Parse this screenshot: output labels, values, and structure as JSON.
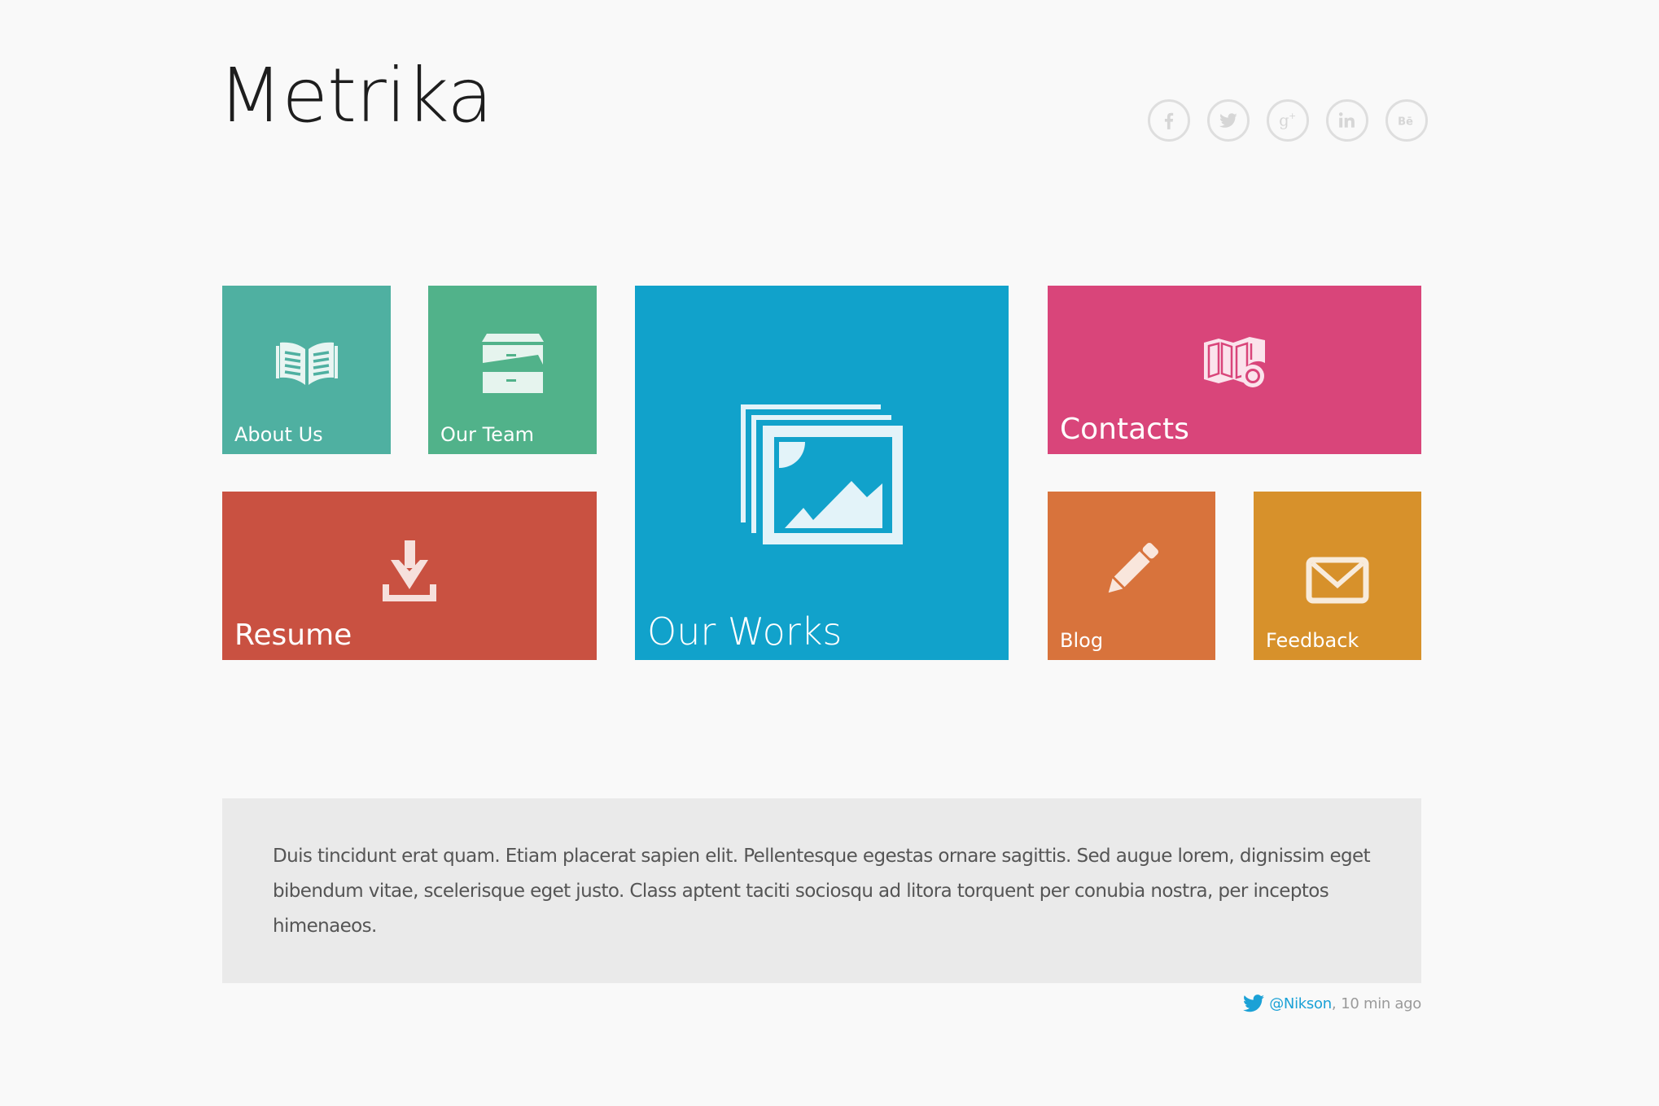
{
  "header": {
    "title": "Metrika",
    "social": [
      {
        "name": "facebook",
        "icon": "facebook-icon"
      },
      {
        "name": "twitter",
        "icon": "twitter-icon"
      },
      {
        "name": "google-plus",
        "icon": "google-plus-icon"
      },
      {
        "name": "linkedin",
        "icon": "linkedin-icon"
      },
      {
        "name": "behance",
        "icon": "behance-icon"
      }
    ]
  },
  "tiles": [
    {
      "label": "About Us",
      "icon": "open-book-icon",
      "color": "#4fb0a1"
    },
    {
      "label": "Our Team",
      "icon": "file-cabinet-icon",
      "color": "#51b28a"
    },
    {
      "label": "Our Works",
      "icon": "image-gallery-icon",
      "color": "#11a2cb"
    },
    {
      "label": "Contacts",
      "icon": "map-pin-icon",
      "color": "#d9457a"
    },
    {
      "label": "Resume",
      "icon": "download-icon",
      "color": "#c95141"
    },
    {
      "label": "Blog",
      "icon": "pencil-icon",
      "color": "#d8733c"
    },
    {
      "label": "Feedback",
      "icon": "envelope-icon",
      "color": "#d7912b"
    }
  ],
  "quote": {
    "text": "Duis tincidunt erat quam. Etiam placerat sapien elit. Pellentesque egestas ornare sagittis. Sed augue lorem, dignissim eget bibendum vitae, scelerisque eget justo. Class aptent taciti sociosqu ad litora torquent per conubia nostra, per inceptos himenaeos."
  },
  "tweet": {
    "handle": "@Nikson",
    "separator": ",",
    "time": "10 min ago",
    "accent_color": "#1ba1d6"
  }
}
